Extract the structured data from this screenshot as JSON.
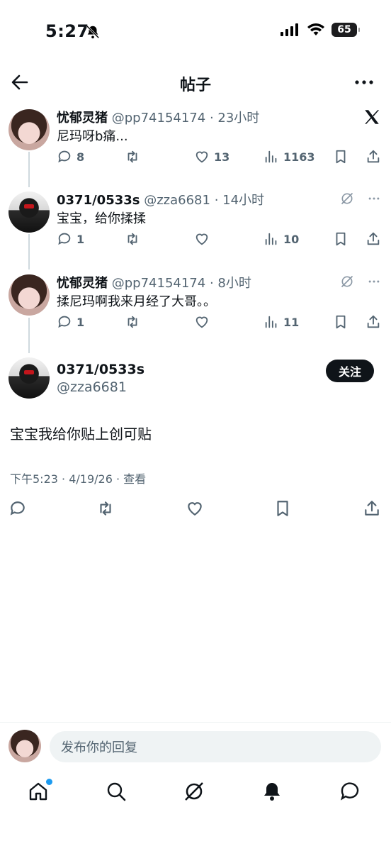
{
  "status": {
    "time": "5:27",
    "battery": "65"
  },
  "header": {
    "title": "帖子"
  },
  "tweets": [
    {
      "name": "忧郁灵猪",
      "handle": "@pp74154174",
      "time": "· 23小时",
      "text": "尼玛呀b痛...",
      "replies": "8",
      "retweets": "",
      "likes": "13",
      "views": "1163"
    },
    {
      "name": "0371/0533s",
      "handle": "@zza6681",
      "time": "· 14小时",
      "text": "宝宝，给你揉揉",
      "replies": "1",
      "retweets": "",
      "likes": "",
      "views": "10"
    },
    {
      "name": "忧郁灵猪",
      "handle": "@pp74154174",
      "time": "· 8小时",
      "text": "揉尼玛啊我来月经了大哥。。",
      "replies": "1",
      "retweets": "",
      "likes": "",
      "views": "11"
    }
  ],
  "main_post": {
    "name": "0371/0533s",
    "handle": "@zza6681",
    "follow_label": "关注",
    "text": "宝宝我给你贴上创可贴",
    "meta": "下午5:23 · 4/19/26 · 查看"
  },
  "reply": {
    "placeholder": "发布你的回复"
  },
  "icons": {
    "reply": "comment-icon",
    "retweet": "retweet-icon",
    "like": "heart-icon",
    "views": "views-icon",
    "bookmark": "bookmark-icon",
    "share": "share-icon",
    "grok": "grok-icon",
    "x": "x-logo-icon"
  }
}
